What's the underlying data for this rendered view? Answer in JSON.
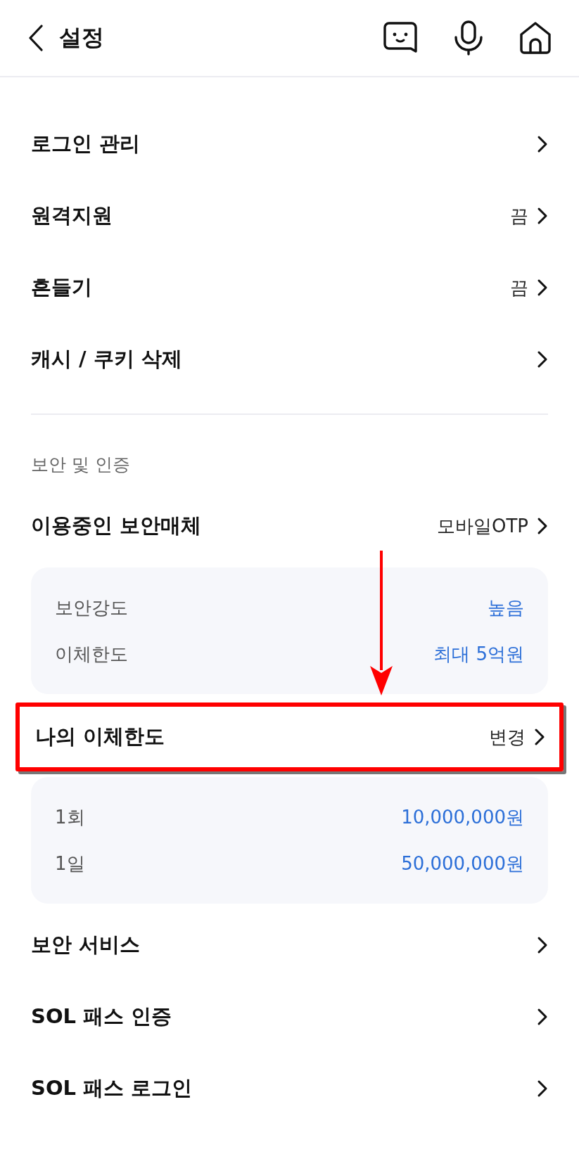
{
  "header": {
    "title": "설정"
  },
  "items": [
    {
      "kind": "row",
      "label": "로그인 관리",
      "highlighted": false
    },
    {
      "kind": "row",
      "label": "원격지원",
      "value": "끔",
      "highlighted": false
    },
    {
      "kind": "row",
      "label": "흔들기",
      "value": "끔",
      "highlighted": false
    },
    {
      "kind": "row",
      "label": "캐시 / 쿠키 삭제",
      "highlighted": false
    },
    {
      "kind": "divider"
    },
    {
      "kind": "section",
      "label": "보안 및 인증"
    },
    {
      "kind": "row",
      "label": "이용중인 보안매체",
      "value": "모바일OTP",
      "highlighted": false
    },
    {
      "kind": "card",
      "arrow": true,
      "lines": [
        {
          "label": "보안강도",
          "value": "높음"
        },
        {
          "label": "이체한도",
          "value": "최대 5억원"
        }
      ]
    },
    {
      "kind": "row",
      "label": "나의 이체한도",
      "value": "변경",
      "highlighted": true
    },
    {
      "kind": "card",
      "arrow": false,
      "lines": [
        {
          "label": "1회",
          "value": "10,000,000원"
        },
        {
          "label": "1일",
          "value": "50,000,000원"
        }
      ]
    },
    {
      "kind": "row",
      "label": "보안 서비스",
      "highlighted": false
    },
    {
      "kind": "row",
      "label": "SOL 패스 인증",
      "highlighted": false
    },
    {
      "kind": "row",
      "label": "SOL 패스 로그인",
      "highlighted": false
    }
  ]
}
